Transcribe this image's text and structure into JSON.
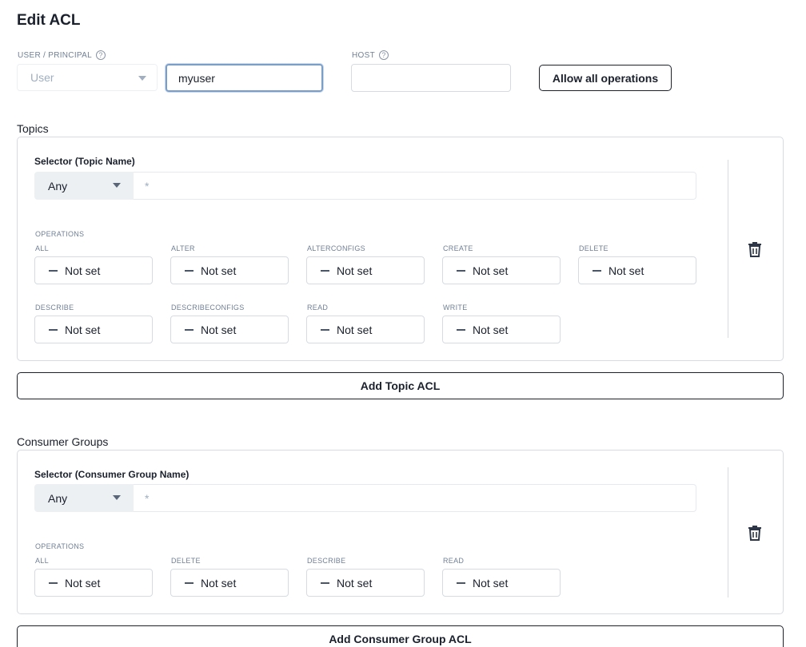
{
  "page": {
    "title": "Edit ACL"
  },
  "principal": {
    "label": "USER / PRINCIPAL",
    "help_icon": "question-circle-icon",
    "type_value": "User",
    "name_value": "myuser"
  },
  "host": {
    "label": "HOST",
    "help_icon": "question-circle-icon",
    "value": ""
  },
  "allow_all_label": "Allow all operations",
  "topics": {
    "heading": "Topics",
    "selector_label": "Selector (Topic Name)",
    "selector_type": "Any",
    "selector_value": "*",
    "operations_label": "OPERATIONS",
    "operations": [
      {
        "name": "ALL",
        "value": "Not set"
      },
      {
        "name": "ALTER",
        "value": "Not set"
      },
      {
        "name": "ALTERCONFIGS",
        "value": "Not set"
      },
      {
        "name": "CREATE",
        "value": "Not set"
      },
      {
        "name": "DELETE",
        "value": "Not set"
      },
      {
        "name": "DESCRIBE",
        "value": "Not set"
      },
      {
        "name": "DESCRIBECONFIGS",
        "value": "Not set"
      },
      {
        "name": "READ",
        "value": "Not set"
      },
      {
        "name": "WRITE",
        "value": "Not set"
      }
    ],
    "add_label": "Add Topic ACL"
  },
  "consumer_groups": {
    "heading": "Consumer Groups",
    "selector_label": "Selector (Consumer Group Name)",
    "selector_type": "Any",
    "selector_value": "*",
    "operations_label": "OPERATIONS",
    "operations": [
      {
        "name": "ALL",
        "value": "Not set"
      },
      {
        "name": "DELETE",
        "value": "Not set"
      },
      {
        "name": "DESCRIBE",
        "value": "Not set"
      },
      {
        "name": "READ",
        "value": "Not set"
      }
    ],
    "add_label": "Add Consumer Group ACL"
  },
  "icons": {
    "delete": "trash-icon",
    "dropdown": "caret-down-icon",
    "not_set": "minus-icon"
  },
  "colors": {
    "focus_border": "#7b9ec9",
    "border": "#d6dbe1",
    "text": "#1a202c",
    "muted": "#718096"
  }
}
